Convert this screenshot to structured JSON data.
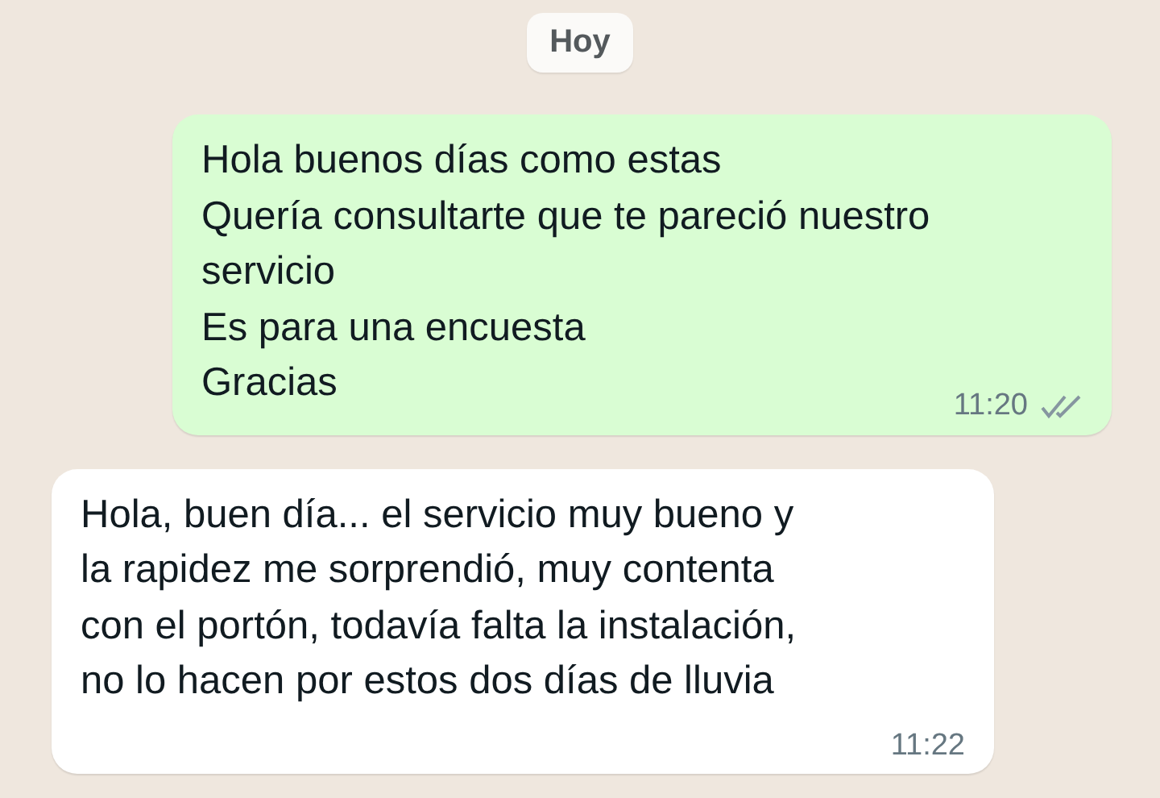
{
  "date_badge": "Hoy",
  "messages": [
    {
      "kind": "outgoing",
      "lines": [
        "Hola buenos días como estas",
        "Quería consultarte que te pareció nuestro",
        "servicio",
        "Es para una encuesta",
        "Gracias"
      ],
      "time": "11:20",
      "read": false
    },
    {
      "kind": "incoming",
      "lines": [
        "Hola, buen día... el servicio muy bueno y",
        "la rapidez me sorprendió, muy contenta",
        "con el portón, todavía falta la instalación,",
        "no lo hacen por estos dos días de lluvia"
      ],
      "time": "11:22"
    }
  ]
}
